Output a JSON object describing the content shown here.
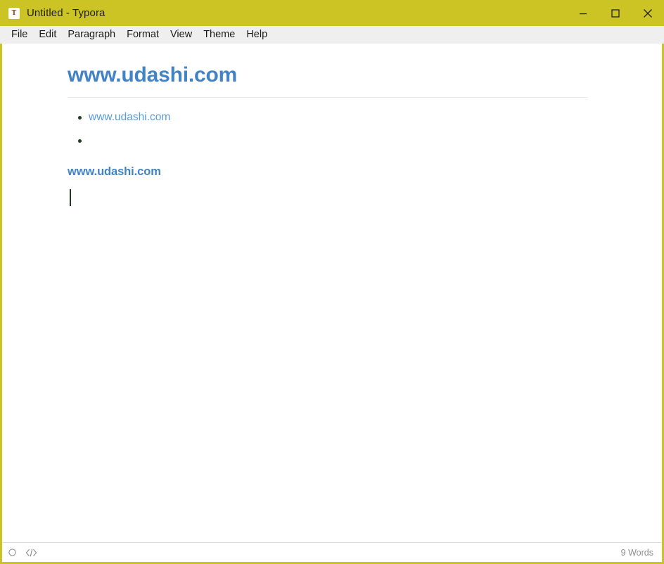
{
  "window": {
    "title": "Untitled - Typora",
    "app_icon": "typora-t-icon",
    "icon_letter": "T",
    "accent_color": "#ccc324",
    "controls": [
      {
        "name": "minimize-button",
        "label": "Minimize"
      },
      {
        "name": "maximize-button",
        "label": "Maximize"
      },
      {
        "name": "close-button",
        "label": "Close"
      }
    ]
  },
  "menubar": {
    "items": [
      {
        "label": "File"
      },
      {
        "label": "Edit"
      },
      {
        "label": "Paragraph"
      },
      {
        "label": "Format"
      },
      {
        "label": "View"
      },
      {
        "label": "Theme"
      },
      {
        "label": "Help"
      }
    ]
  },
  "document": {
    "heading": "www.udashi.com",
    "heading_color": "#4183c4",
    "list": [
      {
        "text": "www.udashi.com",
        "is_link": true
      },
      {
        "text": "",
        "is_link": false
      }
    ],
    "paragraph_link": "www.udashi.com",
    "paragraph_link_color": "#4183c4",
    "link_color": "#5b9bd5"
  },
  "statusbar": {
    "icons": [
      {
        "name": "focus-mode-icon",
        "glyph": "circle"
      },
      {
        "name": "source-code-icon",
        "glyph": "</>"
      }
    ],
    "word_count": "9 Words"
  }
}
